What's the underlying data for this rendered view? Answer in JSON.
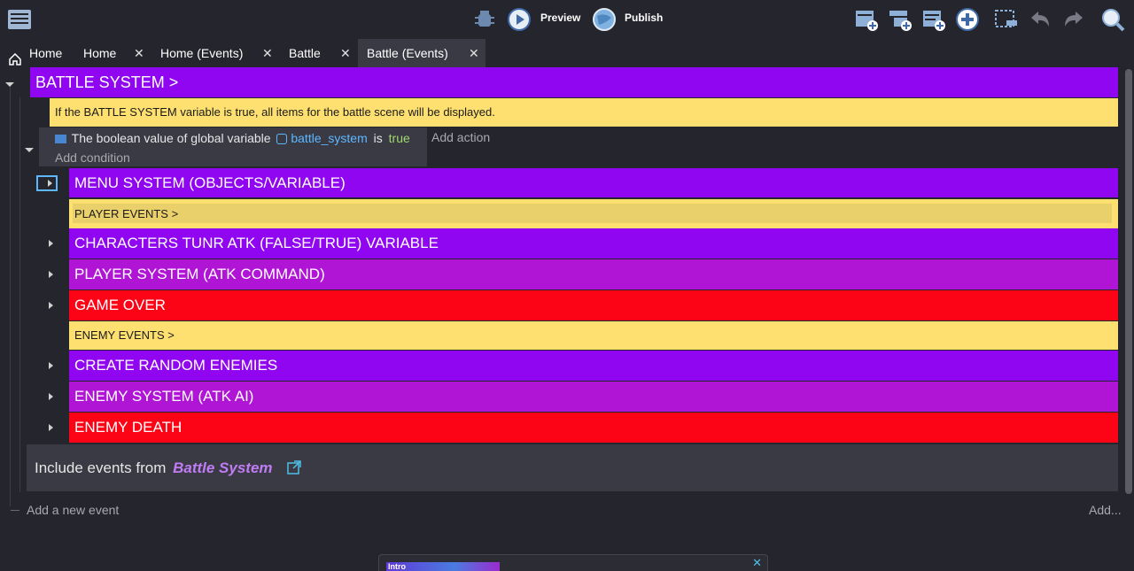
{
  "toolbar": {
    "preview_label": "Preview",
    "publish_label": "Publish"
  },
  "tabs": [
    {
      "label": "Home"
    },
    {
      "label": "Home"
    },
    {
      "label": "Home (Events)"
    },
    {
      "label": "Battle"
    },
    {
      "label": "Battle (Events)"
    }
  ],
  "tab_close_glyph": "✕",
  "events": {
    "group_title": "BATTLE SYSTEM >",
    "comment": "If the BATTLE SYSTEM variable is true, all items for the battle scene will be displayed.",
    "condition": {
      "prefix": "The boolean value of global variable",
      "variable": "battle_system",
      "verb": "is",
      "value": "true",
      "add_condition": "Add condition"
    },
    "add_action": "Add action",
    "subgroups": [
      {
        "label": "MENU SYSTEM (OBJECTS/VARIABLE)"
      },
      {
        "label": "PLAYER EVENTS >"
      },
      {
        "label": "CHARACTERS TUNR ATK (FALSE/TRUE) VARIABLE"
      },
      {
        "label": "PLAYER SYSTEM (ATK COMMAND)"
      },
      {
        "label": "GAME OVER"
      },
      {
        "label": "ENEMY EVENTS >"
      },
      {
        "label": "CREATE RANDOM ENEMIES"
      },
      {
        "label": "ENEMY SYSTEM (ATK AI)"
      },
      {
        "label": "ENEMY DEATH"
      }
    ],
    "include_prefix": "Include events from",
    "include_target": "Battle System",
    "add_new_event": "Add a new event",
    "add_more": "Add..."
  },
  "footer_popup": {
    "tag": "Intro",
    "close_glyph": "✕"
  },
  "colors": {
    "purple": "#9006f0",
    "magenta": "#b015d6",
    "red": "#fc0316",
    "yellow": "#fde070",
    "variable_link": "#5db7ff",
    "value_green": "#9fd86f",
    "include_link": "#c07cf2"
  }
}
